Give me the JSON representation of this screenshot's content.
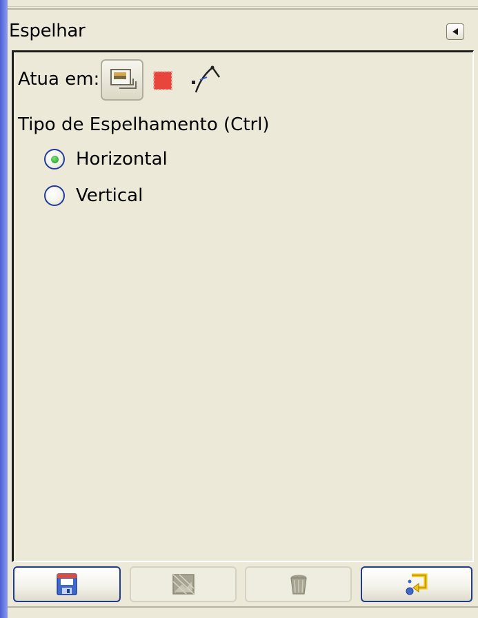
{
  "panel": {
    "title": "Espelhar",
    "collapse_icon": "triangle-left-icon"
  },
  "options": {
    "acts_on_label": "Atua em:",
    "targets": [
      {
        "icon": "layer-icon",
        "selected": true
      },
      {
        "icon": "selection-icon",
        "selected": false
      },
      {
        "icon": "path-icon",
        "selected": false
      }
    ],
    "flip_type_heading": "Tipo de Espelhamento (Ctrl)",
    "radios": [
      {
        "label": "Horizontal",
        "checked": true
      },
      {
        "label": "Vertical",
        "checked": false
      }
    ]
  },
  "buttons": [
    {
      "icon": "save-icon",
      "enabled": true
    },
    {
      "icon": "restore-icon",
      "enabled": false
    },
    {
      "icon": "trash-icon",
      "enabled": false
    },
    {
      "icon": "reset-icon",
      "enabled": true
    }
  ],
  "colors": {
    "background": "#ece9d8",
    "radio_border": "#1f3b9a",
    "radio_dot": "#1f9a1f",
    "selection_red": "#e8453c",
    "reset_yellow": "#f2c40f"
  }
}
